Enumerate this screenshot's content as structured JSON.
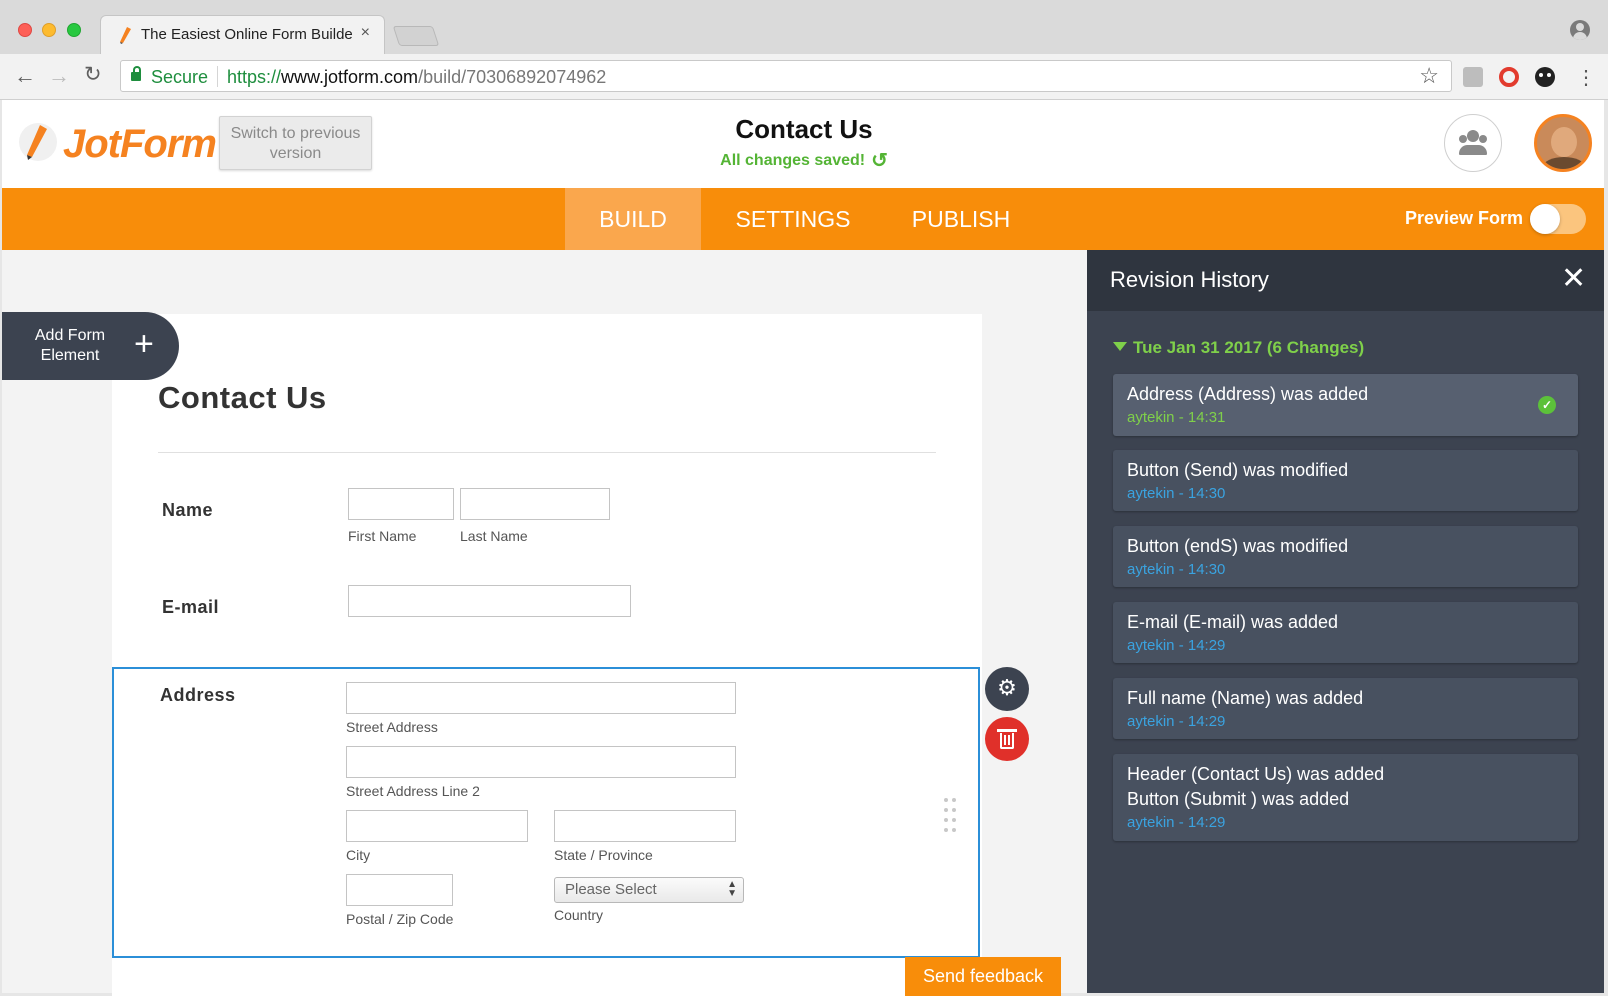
{
  "browser": {
    "tab_title": "The Easiest Online Form Builde",
    "tab_close": "×",
    "secure_label": "Secure",
    "url_scheme": "https://",
    "url_host": "www.jotform.com",
    "url_path": "/build/70306892074962"
  },
  "header": {
    "logo_text": "JotForm",
    "switch_version": "Switch to previous version",
    "form_title": "Contact Us",
    "save_status": "All changes saved!",
    "accent_color": "#f58220"
  },
  "nav": {
    "tabs": [
      "BUILD",
      "SETTINGS",
      "PUBLISH"
    ],
    "active_tab": "BUILD",
    "preview_label": "Preview Form",
    "preview_enabled": false,
    "bar_color": "#f88d0a"
  },
  "builder": {
    "add_element_label": "Add Form Element",
    "form_heading": "Contact Us",
    "fields": {
      "name": {
        "label": "Name",
        "sub_first": "First Name",
        "sub_last": "Last Name"
      },
      "email": {
        "label": "E-mail"
      },
      "address": {
        "label": "Address",
        "sub_street": "Street Address",
        "sub_street2": "Street Address Line 2",
        "sub_city": "City",
        "sub_state": "State / Province",
        "sub_postal": "Postal / Zip Code",
        "sub_country": "Country",
        "country_placeholder": "Please Select"
      }
    },
    "send_feedback": "Send feedback",
    "selected_border_color": "#2b8fd8"
  },
  "revision_history": {
    "title": "Revision History",
    "day_heading": "Tue Jan 31 2017 (6 Changes)",
    "entries": [
      {
        "lines": [
          "Address (Address) was added"
        ],
        "meta": "aytekin - 14:31",
        "current": true
      },
      {
        "lines": [
          "Button (Send) was modified"
        ],
        "meta": "aytekin - 14:30",
        "current": false
      },
      {
        "lines": [
          "Button (endS) was modified"
        ],
        "meta": "aytekin - 14:30",
        "current": false
      },
      {
        "lines": [
          "E-mail (E-mail) was added"
        ],
        "meta": "aytekin - 14:29",
        "current": false
      },
      {
        "lines": [
          "Full name (Name) was added"
        ],
        "meta": "aytekin - 14:29",
        "current": false
      },
      {
        "lines": [
          "Header (Contact Us) was added",
          "Button (Submit ) was added"
        ],
        "meta": "aytekin - 14:29",
        "current": false
      }
    ]
  }
}
